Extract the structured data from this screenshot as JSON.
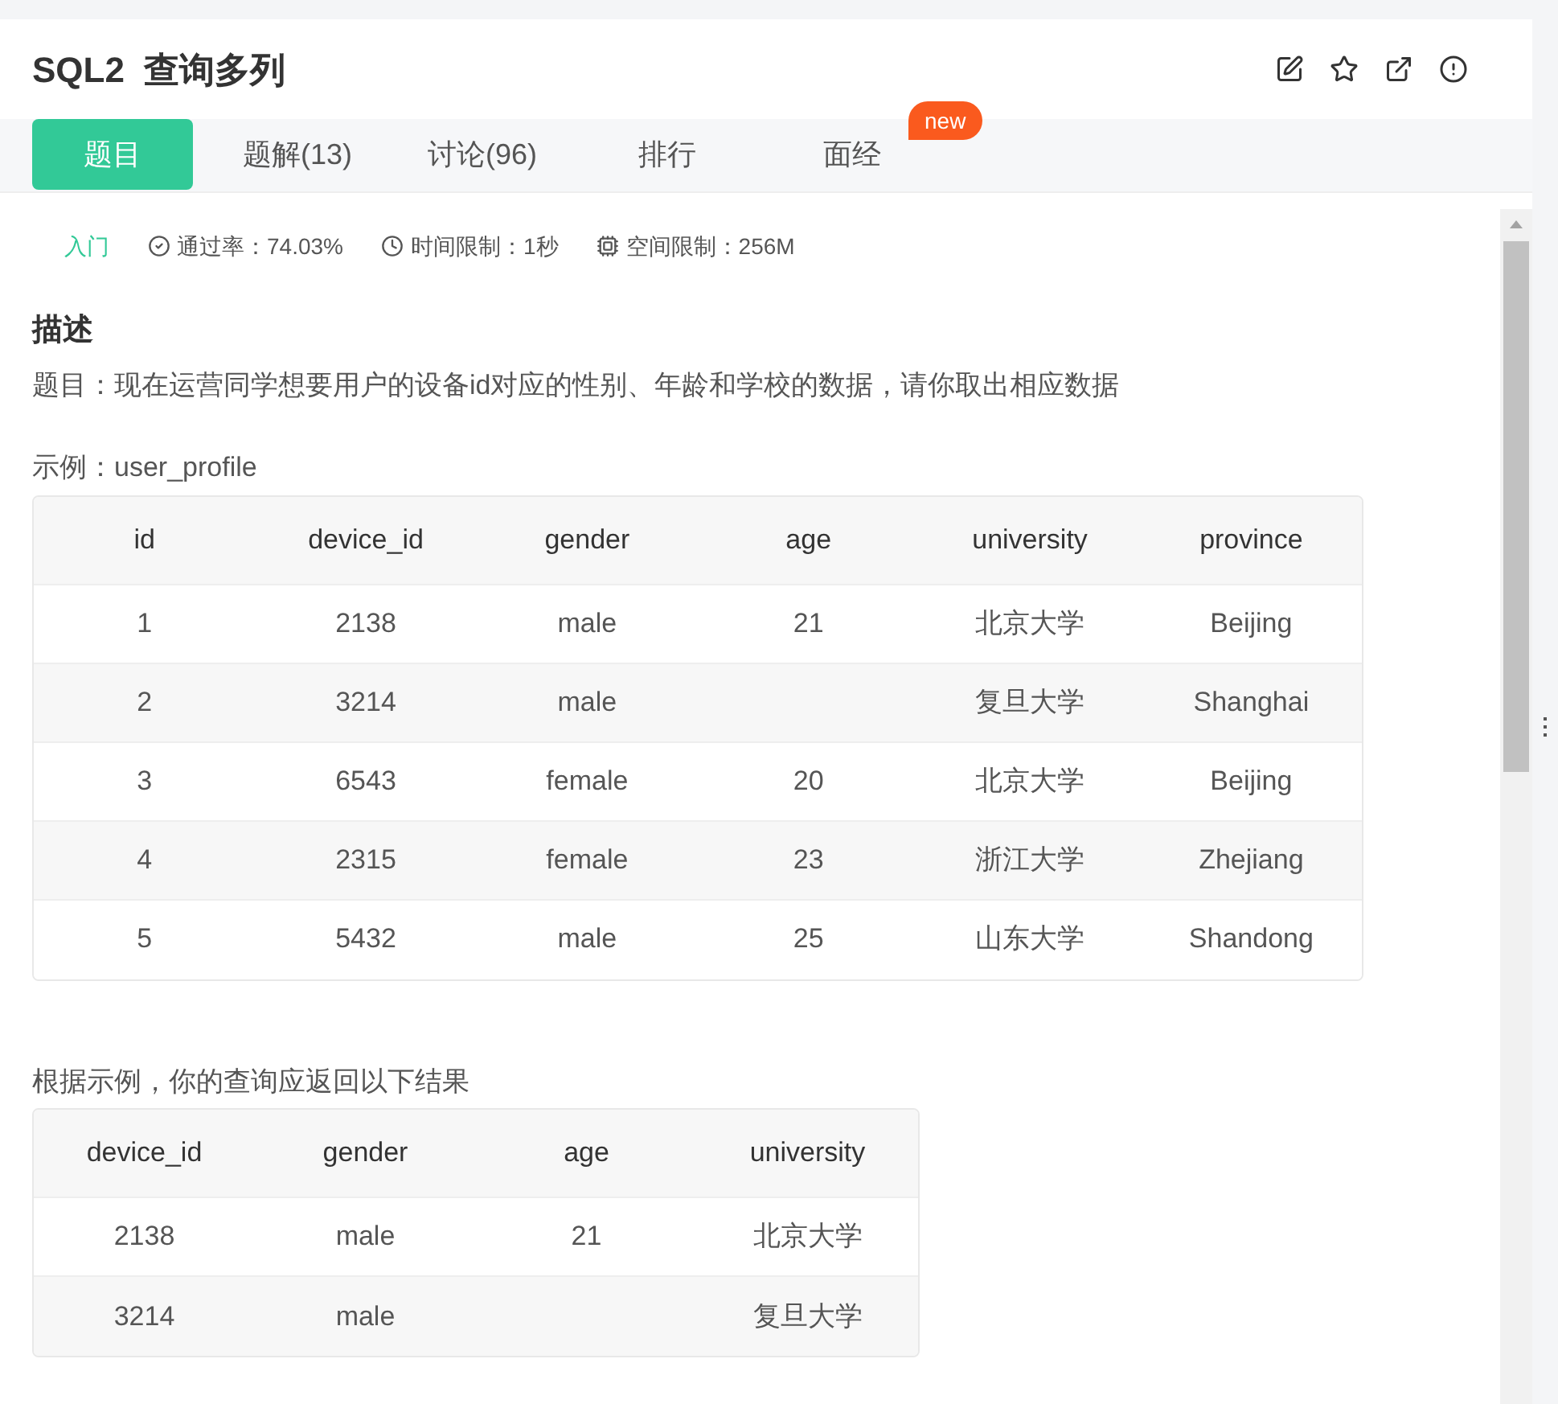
{
  "title": "SQL2  查询多列",
  "tabs": [
    {
      "label": "题目",
      "selected": true
    },
    {
      "label": "题解(13)",
      "selected": false
    },
    {
      "label": "讨论(96)",
      "selected": false
    },
    {
      "label": "排行",
      "selected": false
    },
    {
      "label": "面经",
      "selected": false,
      "badge": "new"
    }
  ],
  "meta": {
    "level": "入门",
    "pass_rate": "通过率：74.03%",
    "time_limit": "时间限制：1秒",
    "memory_limit": "空间限制：256M"
  },
  "description": {
    "heading": "描述",
    "text": "题目：现在运营同学想要用户的设备id对应的性别、年龄和学校的数据，请你取出相应数据"
  },
  "example_table": {
    "caption": "示例：user_profile",
    "columns": [
      "id",
      "device_id",
      "gender",
      "age",
      "university",
      "province"
    ],
    "rows": [
      [
        "1",
        "2138",
        "male",
        "21",
        "北京大学",
        "Beijing"
      ],
      [
        "2",
        "3214",
        "male",
        "",
        "复旦大学",
        "Shanghai"
      ],
      [
        "3",
        "6543",
        "female",
        "20",
        "北京大学",
        "Beijing"
      ],
      [
        "4",
        "2315",
        "female",
        "23",
        "浙江大学",
        "Zhejiang"
      ],
      [
        "5",
        "5432",
        "male",
        "25",
        "山东大学",
        "Shandong"
      ]
    ]
  },
  "result_table": {
    "caption": "根据示例，你的查询应返回以下结果",
    "columns": [
      "device_id",
      "gender",
      "age",
      "university"
    ],
    "rows": [
      [
        "2138",
        "male",
        "21",
        "北京大学"
      ],
      [
        "3214",
        "male",
        "",
        "复旦大学"
      ]
    ]
  }
}
